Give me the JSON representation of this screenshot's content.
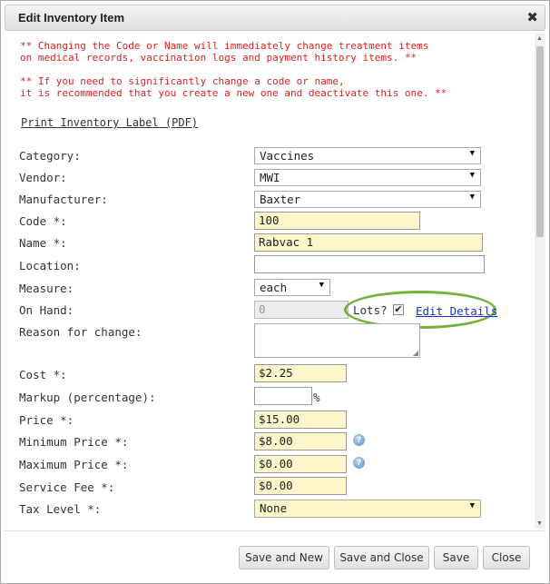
{
  "dialog": {
    "title": "Edit Inventory Item",
    "close_icon": "✖"
  },
  "warnings": {
    "line1": "** Changing the Code or Name will immediately change treatment items",
    "line2": "on medical records, vaccination logs and payment history items. **",
    "line3": "** If you need to significantly change a code or name,",
    "line4": "it is recommended that you create a new one and deactivate this one. **"
  },
  "print_label_link": "Print Inventory Label (PDF)",
  "fields": {
    "category": {
      "label": "Category:",
      "value": "Vaccines"
    },
    "vendor": {
      "label": "Vendor:",
      "value": "MWI"
    },
    "manufacturer": {
      "label": "Manufacturer:",
      "value": "Baxter"
    },
    "code": {
      "label": "Code *:",
      "value": "100"
    },
    "name": {
      "label": "Name *:",
      "value": "Rabvac 1"
    },
    "location": {
      "label": "Location:",
      "value": ""
    },
    "measure": {
      "label": "Measure:",
      "value": "each"
    },
    "on_hand": {
      "label": "On Hand:",
      "value": "0"
    },
    "reason": {
      "label": "Reason for change:",
      "value": ""
    },
    "cost": {
      "label": "Cost *:",
      "value": "$2.25"
    },
    "markup": {
      "label": "Markup (percentage):",
      "value": "",
      "suffix": "%"
    },
    "price": {
      "label": "Price *:",
      "value": "$15.00"
    },
    "min_price": {
      "label": "Minimum Price *:",
      "value": "$8.00"
    },
    "max_price": {
      "label": "Maximum Price *:",
      "value": "$0.00"
    },
    "service_fee": {
      "label": "Service Fee *:",
      "value": "$0.00"
    },
    "tax_level": {
      "label": "Tax Level *:",
      "value": "None"
    }
  },
  "lots": {
    "label": "Lots?",
    "checked": true,
    "edit_details_link": "Edit Details",
    "highlight_color": "#72b33b"
  },
  "icons": {
    "dropdown_arrow": "▼",
    "help": "?",
    "scroll_up": "▲",
    "scroll_down": "▼",
    "resize_grip": "◢",
    "check": "✔"
  },
  "buttons": {
    "save_and_new": "Save and New",
    "save_and_close": "Save and Close",
    "save": "Save",
    "close": "Close"
  }
}
